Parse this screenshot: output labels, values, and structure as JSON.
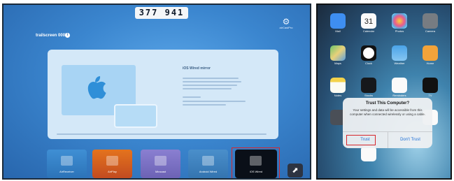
{
  "receiver": {
    "code": "377 941",
    "settings_label": "airCastPro",
    "device_name": "trailscreen 000b",
    "card": {
      "title": "iOS Wired mirror"
    },
    "tiles": [
      {
        "label": "AirReceiver"
      },
      {
        "label": "AirPlay"
      },
      {
        "label": "Miracast"
      },
      {
        "label": "Android Wired"
      },
      {
        "label": "iOS Wired"
      }
    ],
    "accent_color": "#d6262c"
  },
  "iphone": {
    "apps": [
      {
        "label": "Mail"
      },
      {
        "label": "Calendar"
      },
      {
        "label": "Photos"
      },
      {
        "label": "Camera"
      },
      {
        "label": "Maps"
      },
      {
        "label": "Clock"
      },
      {
        "label": "Weather"
      },
      {
        "label": "Home"
      },
      {
        "label": "Notes"
      },
      {
        "label": "Stocks"
      },
      {
        "label": "Reminders"
      },
      {
        "label": "TV"
      }
    ],
    "calendar_day": "31",
    "dialog": {
      "title": "Trust This Computer?",
      "message": "Your settings and data will be accessible from this computer when connected wirelessly or using a cable.",
      "trust_label": "Trust",
      "dont_trust_label": "Don't Trust"
    }
  }
}
